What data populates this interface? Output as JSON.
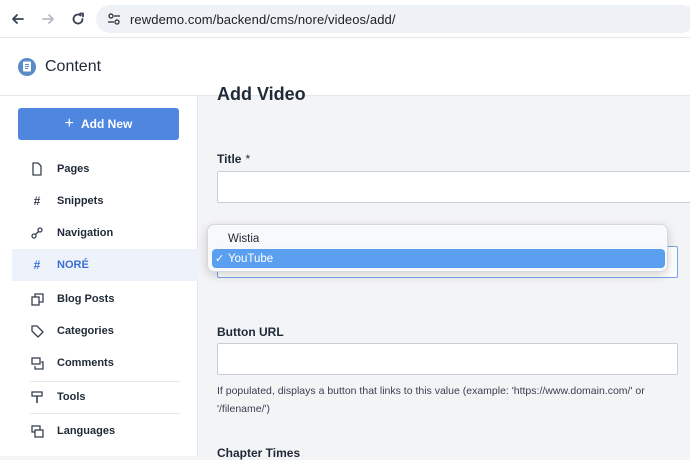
{
  "browser": {
    "url": "rewdemo.com/backend/cms/nore/videos/add/",
    "back_icon": "arrow-left-icon",
    "forward_icon": "arrow-right-icon",
    "reload_icon": "reload-icon"
  },
  "app": {
    "title": "Content"
  },
  "sidebar": {
    "add_new_label": "Add New",
    "items": [
      {
        "label": "Pages",
        "icon": "page-icon"
      },
      {
        "label": "Snippets",
        "icon": "hash-icon"
      },
      {
        "label": "Navigation",
        "icon": "link-icon"
      },
      {
        "label": "NORÉ",
        "icon": "hash-icon",
        "active": true
      },
      {
        "label": "Blog Posts",
        "icon": "blog-icon"
      },
      {
        "label": "Categories",
        "icon": "tag-icon"
      },
      {
        "label": "Comments",
        "icon": "comments-icon"
      },
      {
        "label": "Tools",
        "icon": "tools-icon"
      },
      {
        "label": "Languages",
        "icon": "languages-icon"
      }
    ]
  },
  "form": {
    "heading": "Add Video",
    "title_label": "Title",
    "required_mark": "*",
    "title_value": "",
    "button_url_label": "Button URL",
    "button_url_value": "",
    "button_url_help": "If populated, displays a button that links to this value (example: 'https://www.domain.com/' or '/filename/')",
    "chapter_times_label": "Chapter Times"
  },
  "dropdown": {
    "options": [
      "Wistia",
      "YouTube"
    ],
    "selected": "YouTube",
    "check_mark": "✓"
  },
  "colors": {
    "accent": "#4f86df",
    "active_bg": "#eef3fb",
    "selected_option": "#5b9ff0"
  }
}
